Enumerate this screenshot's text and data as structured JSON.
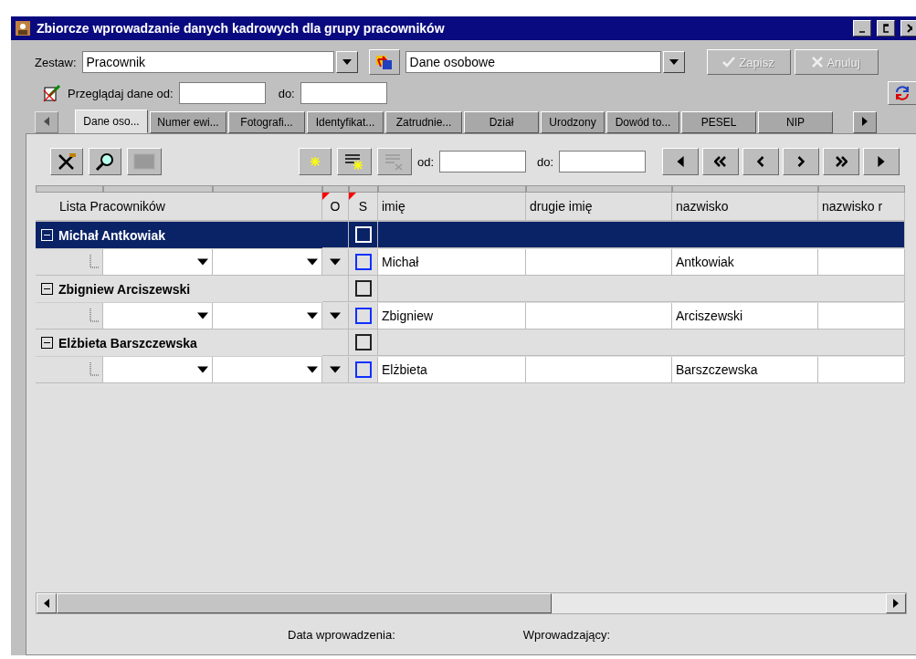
{
  "window": {
    "title": "Zbiorcze wprowadzanie danych kadrowych dla grupy pracowników"
  },
  "top": {
    "set_label": "Zestaw:",
    "set_value": "Pracownik",
    "view_value": "Dane osobowe",
    "buttons": [
      {
        "label": "Zapisz",
        "kind": "save",
        "disabled": true
      },
      {
        "label": "Anuluj",
        "kind": "cancel",
        "disabled": true
      }
    ]
  },
  "browse": {
    "label": "Przeglądaj dane od:",
    "to_label": "do:"
  },
  "tabs": [
    {
      "label": "Dane oso...",
      "selected": true
    },
    {
      "label": "Numer ewi...",
      "selected": false
    },
    {
      "label": "Fotografi...",
      "selected": false
    },
    {
      "label": "Identyfikat...",
      "selected": false
    },
    {
      "label": "Zatrudnie...",
      "selected": false
    },
    {
      "label": "Dział",
      "selected": false
    },
    {
      "label": "Urodzony",
      "selected": false
    },
    {
      "label": "Dowód to...",
      "selected": false
    },
    {
      "label": "PESEL",
      "selected": false
    },
    {
      "label": "NIP",
      "selected": false
    }
  ],
  "toolbar": {
    "from_label": "od:",
    "to_label": "do:"
  },
  "grid": {
    "columns": [
      "Lista Pracowników",
      "O",
      "S",
      "imię",
      "drugie imię",
      "nazwisko",
      "nazwisko r"
    ],
    "rows": [
      {
        "name": "Michał Antkowiak",
        "selected": true,
        "expanded": true,
        "checked": false,
        "detail": {
          "checked": false,
          "first_name": "Michał",
          "last_name": "Antkowiak"
        }
      },
      {
        "name": "Zbigniew Arciszewski",
        "selected": false,
        "expanded": true,
        "checked": false,
        "detail": {
          "checked": false,
          "first_name": "Zbigniew",
          "last_name": "Arciszewski"
        }
      },
      {
        "name": "Elżbieta Barszczewska",
        "selected": false,
        "expanded": true,
        "checked": false,
        "detail": {
          "checked": false,
          "first_name": "Elżbieta",
          "last_name": "Barszczewska"
        }
      }
    ]
  },
  "footer": {
    "date_label": "Data wprowadzenia:",
    "author_label": "Wprowadzający:"
  }
}
